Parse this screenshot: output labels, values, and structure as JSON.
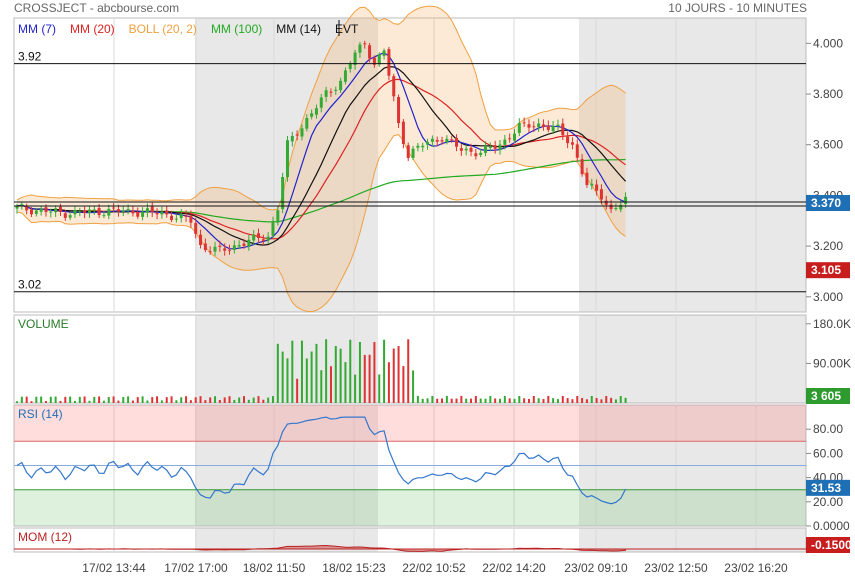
{
  "header": {
    "title": "CROSSJECT - abcbourse.com",
    "period": "10 JOURS - 10 MINUTES"
  },
  "colors": {
    "mm7": "#2222cc",
    "mm20": "#dd2222",
    "boll": "#f0a040",
    "mm100": "#22aa22",
    "mm14": "#111111",
    "rsi": "#3377cc",
    "mom": "#bb2222",
    "up": "#33aa33",
    "down": "#dd3333"
  },
  "main_legend": [
    {
      "label": "MM (7)",
      "color": "#2222cc"
    },
    {
      "label": "MM (20)",
      "color": "#dd2222"
    },
    {
      "label": "BOLL (20, 2)",
      "color": "#f0a040"
    },
    {
      "label": "MM (100)",
      "color": "#22aa22"
    },
    {
      "label": "MM (14)",
      "color": "#111111"
    },
    {
      "label": "EVT",
      "color": "#111111"
    }
  ],
  "levels": {
    "high": "3.92",
    "low": "3.02"
  },
  "badges": {
    "last": {
      "text": "3.370",
      "color": "#1f6fb5"
    },
    "ref": {
      "text": "3.105",
      "color": "#c81d1d"
    },
    "volume": {
      "text": "3 605",
      "color": "#2e9b2e"
    },
    "rsi": {
      "text": "31.53",
      "color": "#1f6fb5"
    },
    "mom": {
      "text": "-0.1500",
      "color": "#c81d1d"
    }
  },
  "panels": {
    "volume": "VOLUME",
    "rsi": "RSI (14)",
    "mom": "MOM (12)"
  },
  "price_ticks": [
    "3.000",
    "3.200",
    "3.400",
    "3.600",
    "3.800",
    "4.000"
  ],
  "volume_ticks": [
    "90.00K",
    "180.0K"
  ],
  "rsi_ticks": [
    "0.0000",
    "20.00",
    "40.00",
    "60.00",
    "80.00"
  ],
  "x_ticks": [
    "17/02 13:44",
    "17/02 17:00",
    "18/02 11:50",
    "18/02 15:23",
    "22/02 10:52",
    "22/02 14:20",
    "23/02 09:10",
    "23/02 12:50",
    "23/02 16:20"
  ],
  "chart_data": {
    "type": "candlestick",
    "title": "CROSSJECT - abcbourse.com",
    "y_range": [
      2.94,
      4.1
    ],
    "levels": [
      3.92,
      3.02
    ],
    "last_price": 3.37,
    "reference_price": 3.105,
    "x_labels": [
      "17/02 13:44",
      "17/02 17:00",
      "18/02 11:50",
      "18/02 15:23",
      "22/02 10:52",
      "22/02 14:20",
      "23/02 09:10",
      "23/02 12:50",
      "23/02 16:20"
    ],
    "close_anchors": [
      [
        0,
        3.35
      ],
      [
        10,
        3.33
      ],
      [
        20,
        3.34
      ],
      [
        30,
        3.33
      ],
      [
        36,
        3.3
      ],
      [
        38,
        3.2
      ],
      [
        42,
        3.18
      ],
      [
        48,
        3.22
      ],
      [
        52,
        3.24
      ],
      [
        54,
        3.35
      ],
      [
        56,
        3.6
      ],
      [
        60,
        3.7
      ],
      [
        64,
        3.8
      ],
      [
        67,
        3.85
      ],
      [
        70,
        3.96
      ],
      [
        72,
        4.0
      ],
      [
        74,
        3.92
      ],
      [
        76,
        3.97
      ],
      [
        78,
        3.78
      ],
      [
        79,
        3.68
      ],
      [
        81,
        3.56
      ],
      [
        84,
        3.6
      ],
      [
        88,
        3.63
      ],
      [
        92,
        3.58
      ],
      [
        96,
        3.57
      ],
      [
        100,
        3.6
      ],
      [
        104,
        3.67
      ],
      [
        108,
        3.68
      ],
      [
        112,
        3.66
      ],
      [
        115,
        3.6
      ],
      [
        118,
        3.44
      ],
      [
        121,
        3.4
      ],
      [
        123,
        3.34
      ],
      [
        126,
        3.38
      ]
    ],
    "volume_range": [
      0,
      200000
    ],
    "rsi_range": [
      0,
      100
    ],
    "rsi_bands": [
      30,
      70
    ],
    "mom_value": -0.15,
    "series": [
      {
        "name": "MM (7)",
        "color": "#2222cc"
      },
      {
        "name": "MM (20)",
        "color": "#dd2222"
      },
      {
        "name": "BOLL (20, 2)",
        "color": "#f0a040"
      },
      {
        "name": "MM (100)",
        "color": "#22aa22"
      },
      {
        "name": "MM (14)",
        "color": "#111111"
      }
    ]
  }
}
